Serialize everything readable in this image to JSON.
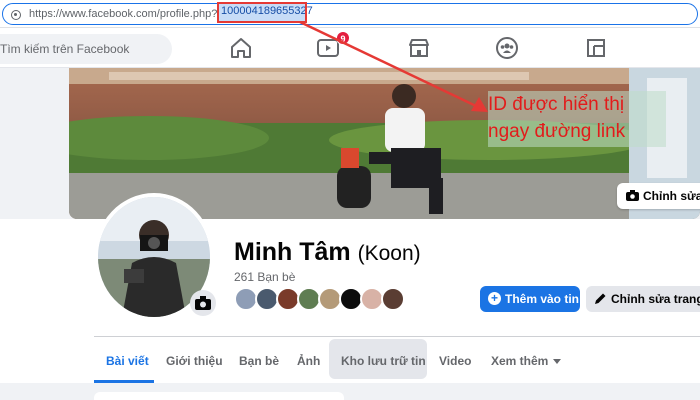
{
  "browser": {
    "url_prefix": "https://www.facebook.com/profile.php?id=",
    "url_id": "100004189655327"
  },
  "header": {
    "search_placeholder": "Tìm kiếm trên Facebook",
    "watch_badge": "9"
  },
  "cover": {
    "annotation_line1": "ID được hiển thị",
    "annotation_line2": "ngay đường link",
    "edit_cover_label": "Chỉnh sửa ả"
  },
  "profile": {
    "name": "Minh Tâm",
    "nickname": "(Koon)",
    "friends": "261 Bạn bè",
    "add_story_label": "Thêm vào tin",
    "edit_profile_label": "Chỉnh sửa trang c"
  },
  "tabs": [
    {
      "label": "Bài viết"
    },
    {
      "label": "Giới thiệu"
    },
    {
      "label": "Bạn bè"
    },
    {
      "label": "Ảnh"
    },
    {
      "label": "Kho lưu trữ tin"
    },
    {
      "label": "Video"
    },
    {
      "label": "Xem thêm"
    }
  ],
  "colors": {
    "accent": "#1b74e4",
    "annotation": "#e21b1b",
    "badge": "#e41e3f"
  },
  "icons": {
    "url": "site-info-icon",
    "home": "home-icon",
    "watch": "video-play-icon",
    "marketplace": "marketplace-icon",
    "groups": "groups-icon",
    "gaming": "gaming-icon",
    "camera": "camera-icon",
    "pencil": "pencil-icon"
  }
}
